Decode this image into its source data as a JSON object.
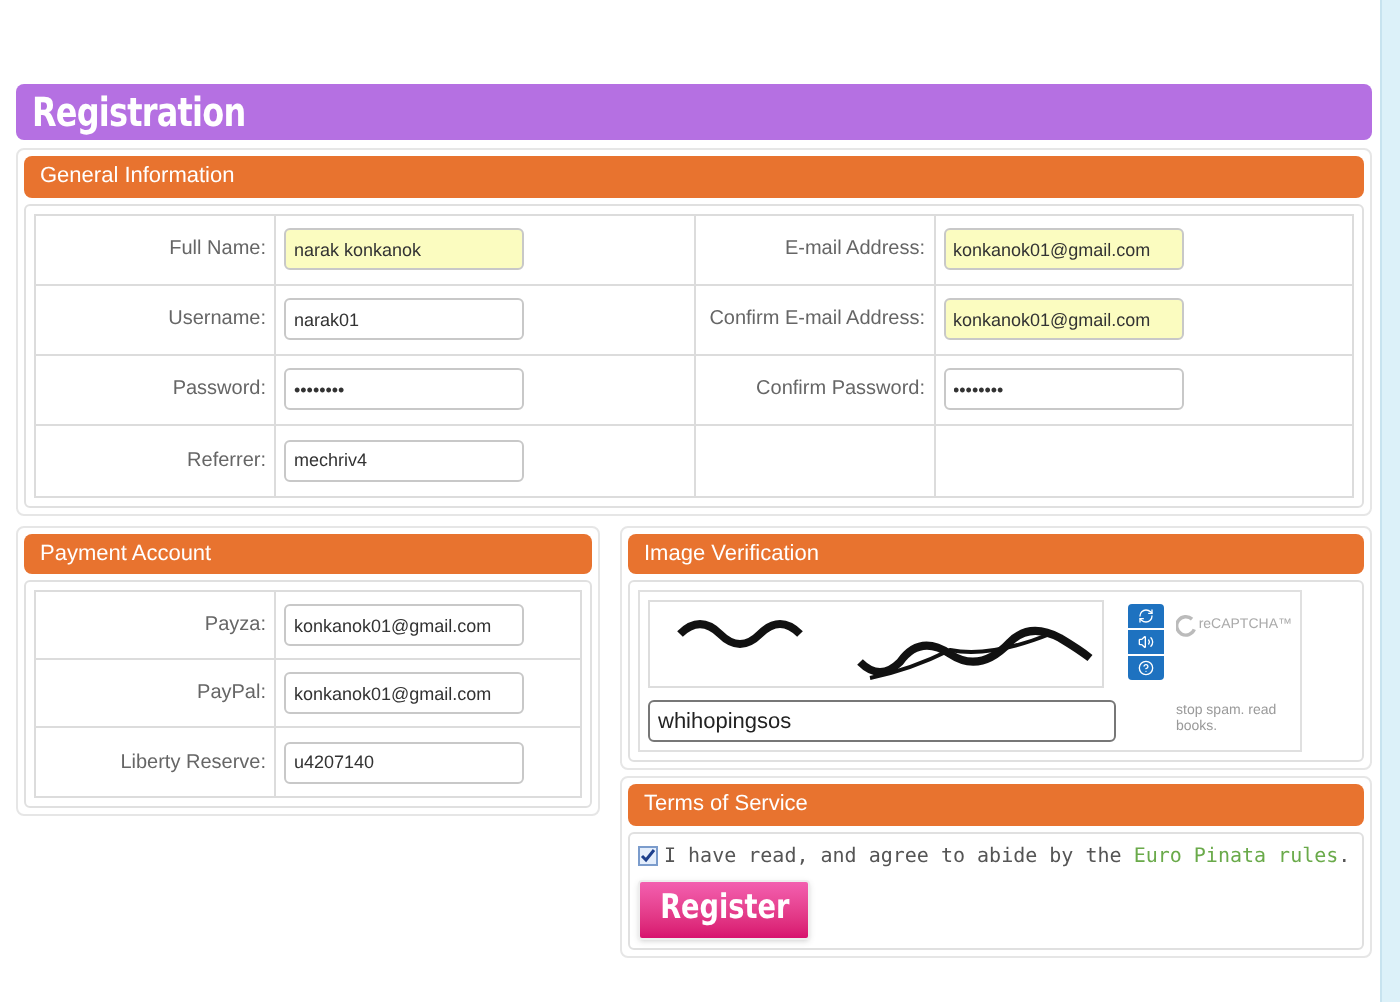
{
  "title": "Registration",
  "general": {
    "heading": "General Information",
    "left": [
      {
        "label": "Full Name:",
        "value": "narak konkanok",
        "highlighted": true
      },
      {
        "label": "Username:",
        "value": "narak01",
        "highlighted": false
      },
      {
        "label": "Password:",
        "value": "••••••••",
        "highlighted": false
      },
      {
        "label": "Referrer:",
        "value": "mechriv4",
        "highlighted": false
      }
    ],
    "right": [
      {
        "label": "E-mail Address:",
        "value": "konkanok01@gmail.com",
        "highlighted": true
      },
      {
        "label": "Confirm E-mail Address:",
        "value": "konkanok01@gmail.com",
        "highlighted": true
      },
      {
        "label": "Confirm Password:",
        "value": "••••••••",
        "highlighted": false
      }
    ]
  },
  "payment": {
    "heading": "Payment Account",
    "fields": [
      {
        "label": "Payza:",
        "value": "konkanok01@gmail.com"
      },
      {
        "label": "PayPal:",
        "value": "konkanok01@gmail.com"
      },
      {
        "label": "Liberty Reserve:",
        "value": "u4207140"
      }
    ]
  },
  "verification": {
    "heading": "Image Verification",
    "answer": "whihopingsos",
    "logo": "reCAPTCHA™",
    "tagline": "stop spam. read books."
  },
  "terms": {
    "heading": "Terms of Service",
    "checked": true,
    "text": "I have read, and agree to abide by the",
    "link": "Euro Pinata rules",
    "after": ".",
    "button": "Register"
  }
}
